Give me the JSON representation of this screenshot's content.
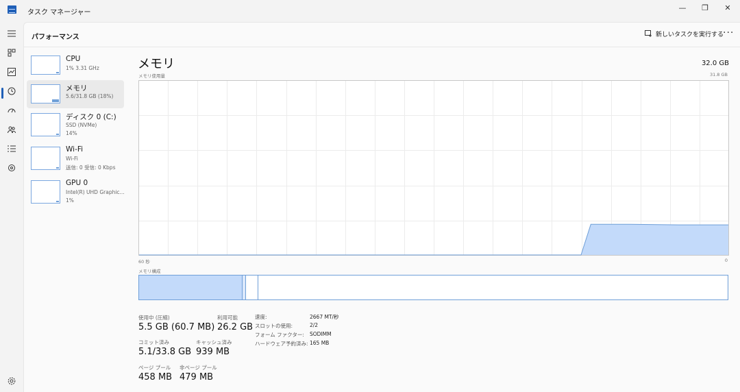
{
  "window": {
    "title": "タスク マネージャー",
    "minimize": "—",
    "maximize": "❐",
    "close": "✕"
  },
  "nav": {
    "icons": [
      "menu-icon",
      "processes-icon",
      "performance-icon",
      "app-history-icon",
      "startup-icon",
      "users-icon",
      "details-icon",
      "services-icon",
      "settings-icon"
    ]
  },
  "header": {
    "title": "パフォーマンス",
    "run_task_label": "新しいタスクを実行する",
    "more_label": "···"
  },
  "resources": [
    {
      "name": "CPU",
      "sub1": "1% 3.31 GHz",
      "sub2": ""
    },
    {
      "name": "メモリ",
      "sub1": "5.6/31.8 GB (18%)",
      "sub2": ""
    },
    {
      "name": "ディスク 0 (C:)",
      "sub1": "SSD (NVMe)",
      "sub2": "14%"
    },
    {
      "name": "Wi-Fi",
      "sub1": "Wi-Fi",
      "sub2": "送信: 0 受信: 0 Kbps"
    },
    {
      "name": "GPU 0",
      "sub1": "Intel(R) UHD Graphic...",
      "sub2": "1%"
    }
  ],
  "memory": {
    "title": "メモリ",
    "total": "32.0 GB",
    "usage_label": "メモリ使用量",
    "usage_max": "31.8 GB",
    "axis_left": "60 秒",
    "axis_right": "0",
    "composition_label": "メモリ構成",
    "in_use_fraction": 0.175,
    "stats": {
      "in_use_label": "使用中 (圧縮)",
      "in_use_value": "5.5 GB (60.7 MB)",
      "available_label": "利用可能",
      "available_value": "26.2 GB",
      "committed_label": "コミット済み",
      "committed_value": "5.1/33.8 GB",
      "cached_label": "キャッシュ済み",
      "cached_value": "939 MB",
      "paged_label": "ページ プール",
      "paged_value": "458 MB",
      "nonpaged_label": "非ページ プール",
      "nonpaged_value": "479 MB"
    },
    "specs": [
      {
        "label": "速度:",
        "value": "2667 MT/秒"
      },
      {
        "label": "スロットの使用:",
        "value": "2/2"
      },
      {
        "label": "フォーム ファクター:",
        "value": "SODIMM"
      },
      {
        "label": "ハードウェア予約済み:",
        "value": "165 MB"
      }
    ]
  },
  "chart_data": {
    "type": "area",
    "x": [
      60,
      50,
      40,
      30,
      20,
      15,
      14,
      13,
      10,
      5,
      0
    ],
    "values": [
      0,
      0,
      0,
      0,
      0,
      0,
      5.6,
      5.6,
      5.6,
      5.5,
      5.5
    ],
    "ylim": [
      0,
      31.8
    ],
    "xlim": [
      60,
      0
    ],
    "grid": true,
    "colors": {
      "fill": "#c3dafa",
      "line": "#6f9fd8"
    }
  }
}
